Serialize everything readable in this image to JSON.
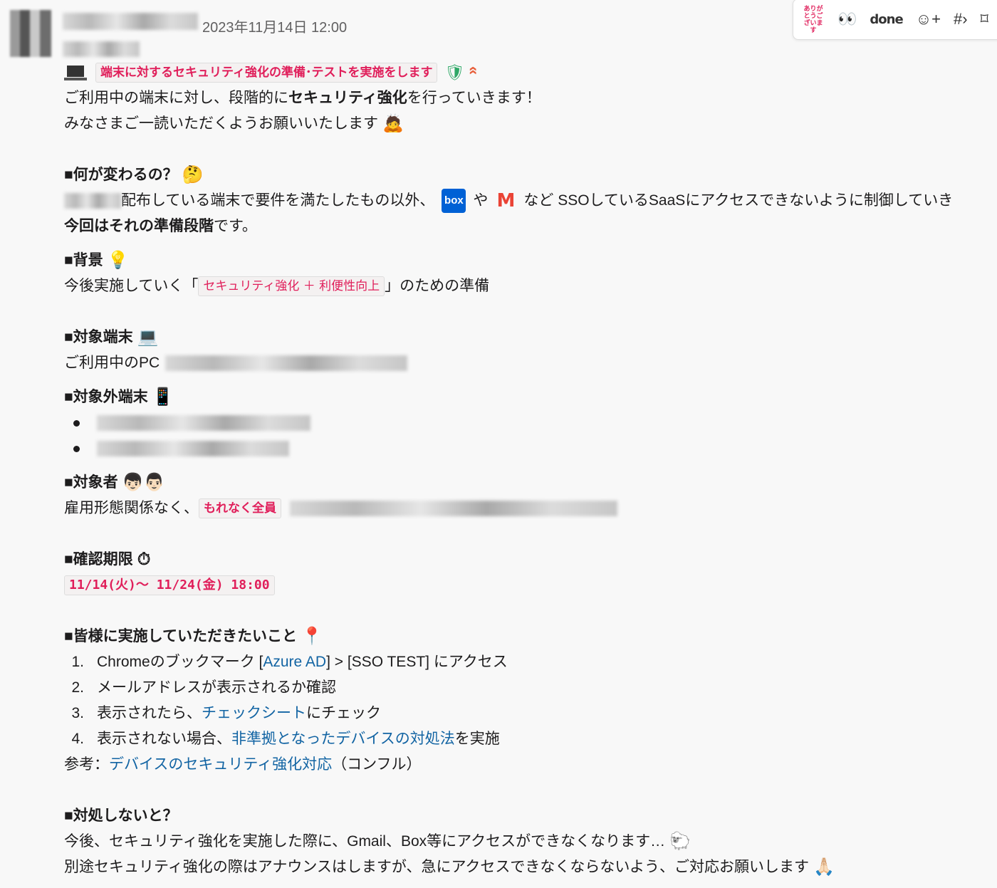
{
  "message": {
    "timestamp": "2023年11月14日 12:00"
  },
  "toolbar": {
    "arigato_label": "ありがとうございます",
    "eyes_label": "👀",
    "done_label": "done",
    "add_reaction_icon": "☺+",
    "hash_icon": "#›",
    "bookmark_icon": "⌑"
  },
  "title": "端末に対するセキュリティ強化の準備･テストを実施をします",
  "intro": {
    "line1_a": "ご利用中の端末に対し、段階的に",
    "line1_b": "セキュリティ強化",
    "line1_c": "を行っていきます！",
    "line2": "みなさまご一読いただくようお願いいたします",
    "line2_emoji": "🙇"
  },
  "sec_what": {
    "heading": "■何が変わるの？",
    "emoji": "🤔",
    "line1_a": "配布している端末で要件を満たしたもの以外、",
    "box": "box",
    "ya": "や",
    "gmail": "M",
    "line1_b": "など SSOしているSaaSにアクセスできないように制御していき",
    "line2_a": "今回はそれの準備段階",
    "line2_b": "です。"
  },
  "sec_bg": {
    "heading": "■背景",
    "emoji": "💡",
    "line_a": "今後実施していく「",
    "code": "セキュリティ強化 ＋ 利便性向上",
    "line_b": "」のための準備"
  },
  "sec_target": {
    "heading": "■対象端末",
    "emoji": "💻",
    "line": "ご利用中のPC"
  },
  "sec_excluded": {
    "heading": "■対象外端末",
    "emoji": "📱"
  },
  "sec_people": {
    "heading": "■対象者",
    "emoji": "👦🏻👨🏻",
    "line_a": "雇用形態関係なく、",
    "code": "もれなく全員"
  },
  "sec_deadline": {
    "heading": "■確認期限",
    "emoji": "⏱",
    "code": "11/14(火)〜 11/24(金) 18:00"
  },
  "sec_todo": {
    "heading": "■皆様に実施していただきたいこと",
    "emoji": "📍",
    "items": [
      {
        "num": "1.",
        "a": "Chromeのブックマーク [",
        "link": "Azure AD",
        "b": "] > [SSO TEST] にアクセス"
      },
      {
        "num": "2.",
        "a": "メールアドレスが表示されるか確認",
        "link": "",
        "b": ""
      },
      {
        "num": "3.",
        "a": "表示されたら、",
        "link": "チェックシート",
        "b": " にチェック"
      },
      {
        "num": "4.",
        "a": "表示されない場合、",
        "link": "非準拠となったデバイスの対処法",
        "b": " を実施"
      }
    ],
    "ref_a": "参考：",
    "ref_link": "デバイスのセキュリティ強化対応",
    "ref_b": "（コンフル）"
  },
  "sec_notdo": {
    "heading": "■対処しないと？",
    "line1": "今後、セキュリティ強化を実施した際に、Gmail、Box等にアクセスができなくなります…",
    "line1_emoji": "🐑",
    "line2": "別途セキュリティ強化の際はアナウンスはしますが、急にアクセスできなくならないよう、ご対応お願いします",
    "line2_emoji": "🙏🏻"
  },
  "colors": {
    "code_text": "#e01e5a",
    "link": "#1264a3",
    "background": "#f8f8f8"
  }
}
